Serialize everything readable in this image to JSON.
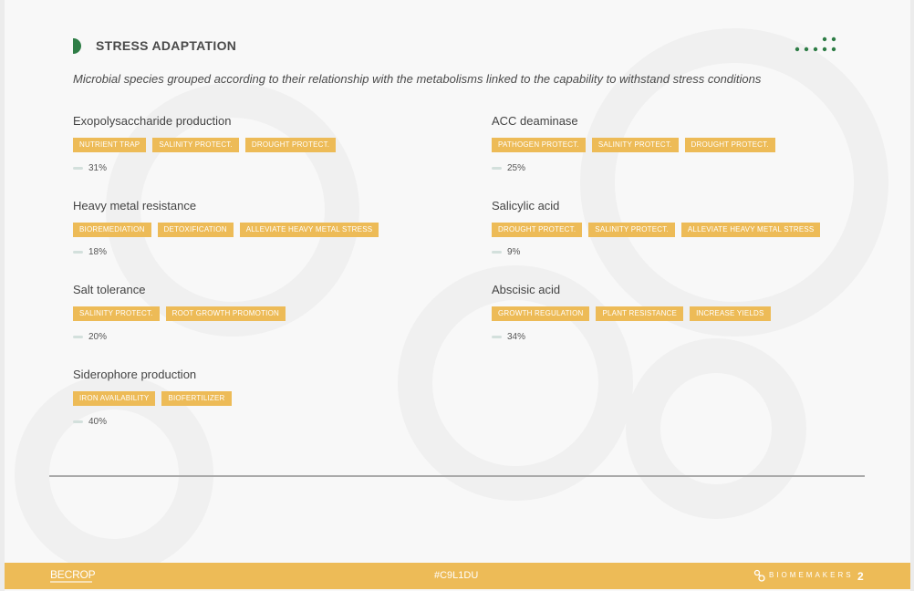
{
  "header": {
    "title": "STRESS ADAPTATION",
    "accent_color": "#2e7d46"
  },
  "subtitle": "Microbial species grouped according to their relationship with the metabolisms linked to the capability to withstand stress conditions",
  "left_column": [
    {
      "title": "Exopolysaccharide production",
      "tags": [
        "NUTRIENT TRAP",
        "SALINITY PROTECT.",
        "DROUGHT PROTECT."
      ],
      "percent": "31%"
    },
    {
      "title": "Heavy metal resistance",
      "tags": [
        "BIOREMEDIATION",
        "DETOXIFICATION",
        "ALLEVIATE HEAVY METAL STRESS"
      ],
      "percent": "18%"
    },
    {
      "title": "Salt tolerance",
      "tags": [
        "SALINITY PROTECT.",
        "ROOT GROWTH PROMOTION"
      ],
      "percent": "20%"
    },
    {
      "title": "Siderophore production",
      "tags": [
        "IRON AVAILABILITY",
        "BIOFERTILIZER"
      ],
      "percent": "40%"
    }
  ],
  "right_column": [
    {
      "title": "ACC deaminase",
      "tags": [
        "PATHOGEN PROTECT.",
        "SALINITY PROTECT.",
        "DROUGHT PROTECT."
      ],
      "percent": "25%"
    },
    {
      "title": "Salicylic acid",
      "tags": [
        "DROUGHT PROTECT.",
        "SALINITY PROTECT.",
        "ALLEVIATE HEAVY METAL STRESS"
      ],
      "percent": "9%"
    },
    {
      "title": "Abscisic acid",
      "tags": [
        "GROWTH REGULATION",
        "PLANT RESISTANCE",
        "INCREASE YIELDS"
      ],
      "percent": "34%"
    }
  ],
  "footer": {
    "brand": "BECROP",
    "code": "#C9L1DU",
    "company": "BIOMEMAKERS",
    "page_number": "2",
    "color": "#edbb57"
  },
  "icons": {
    "header_mark": "half-circle-icon",
    "dots": "dots-pattern-icon",
    "footer_logo": "biomemakers-logo-icon"
  }
}
